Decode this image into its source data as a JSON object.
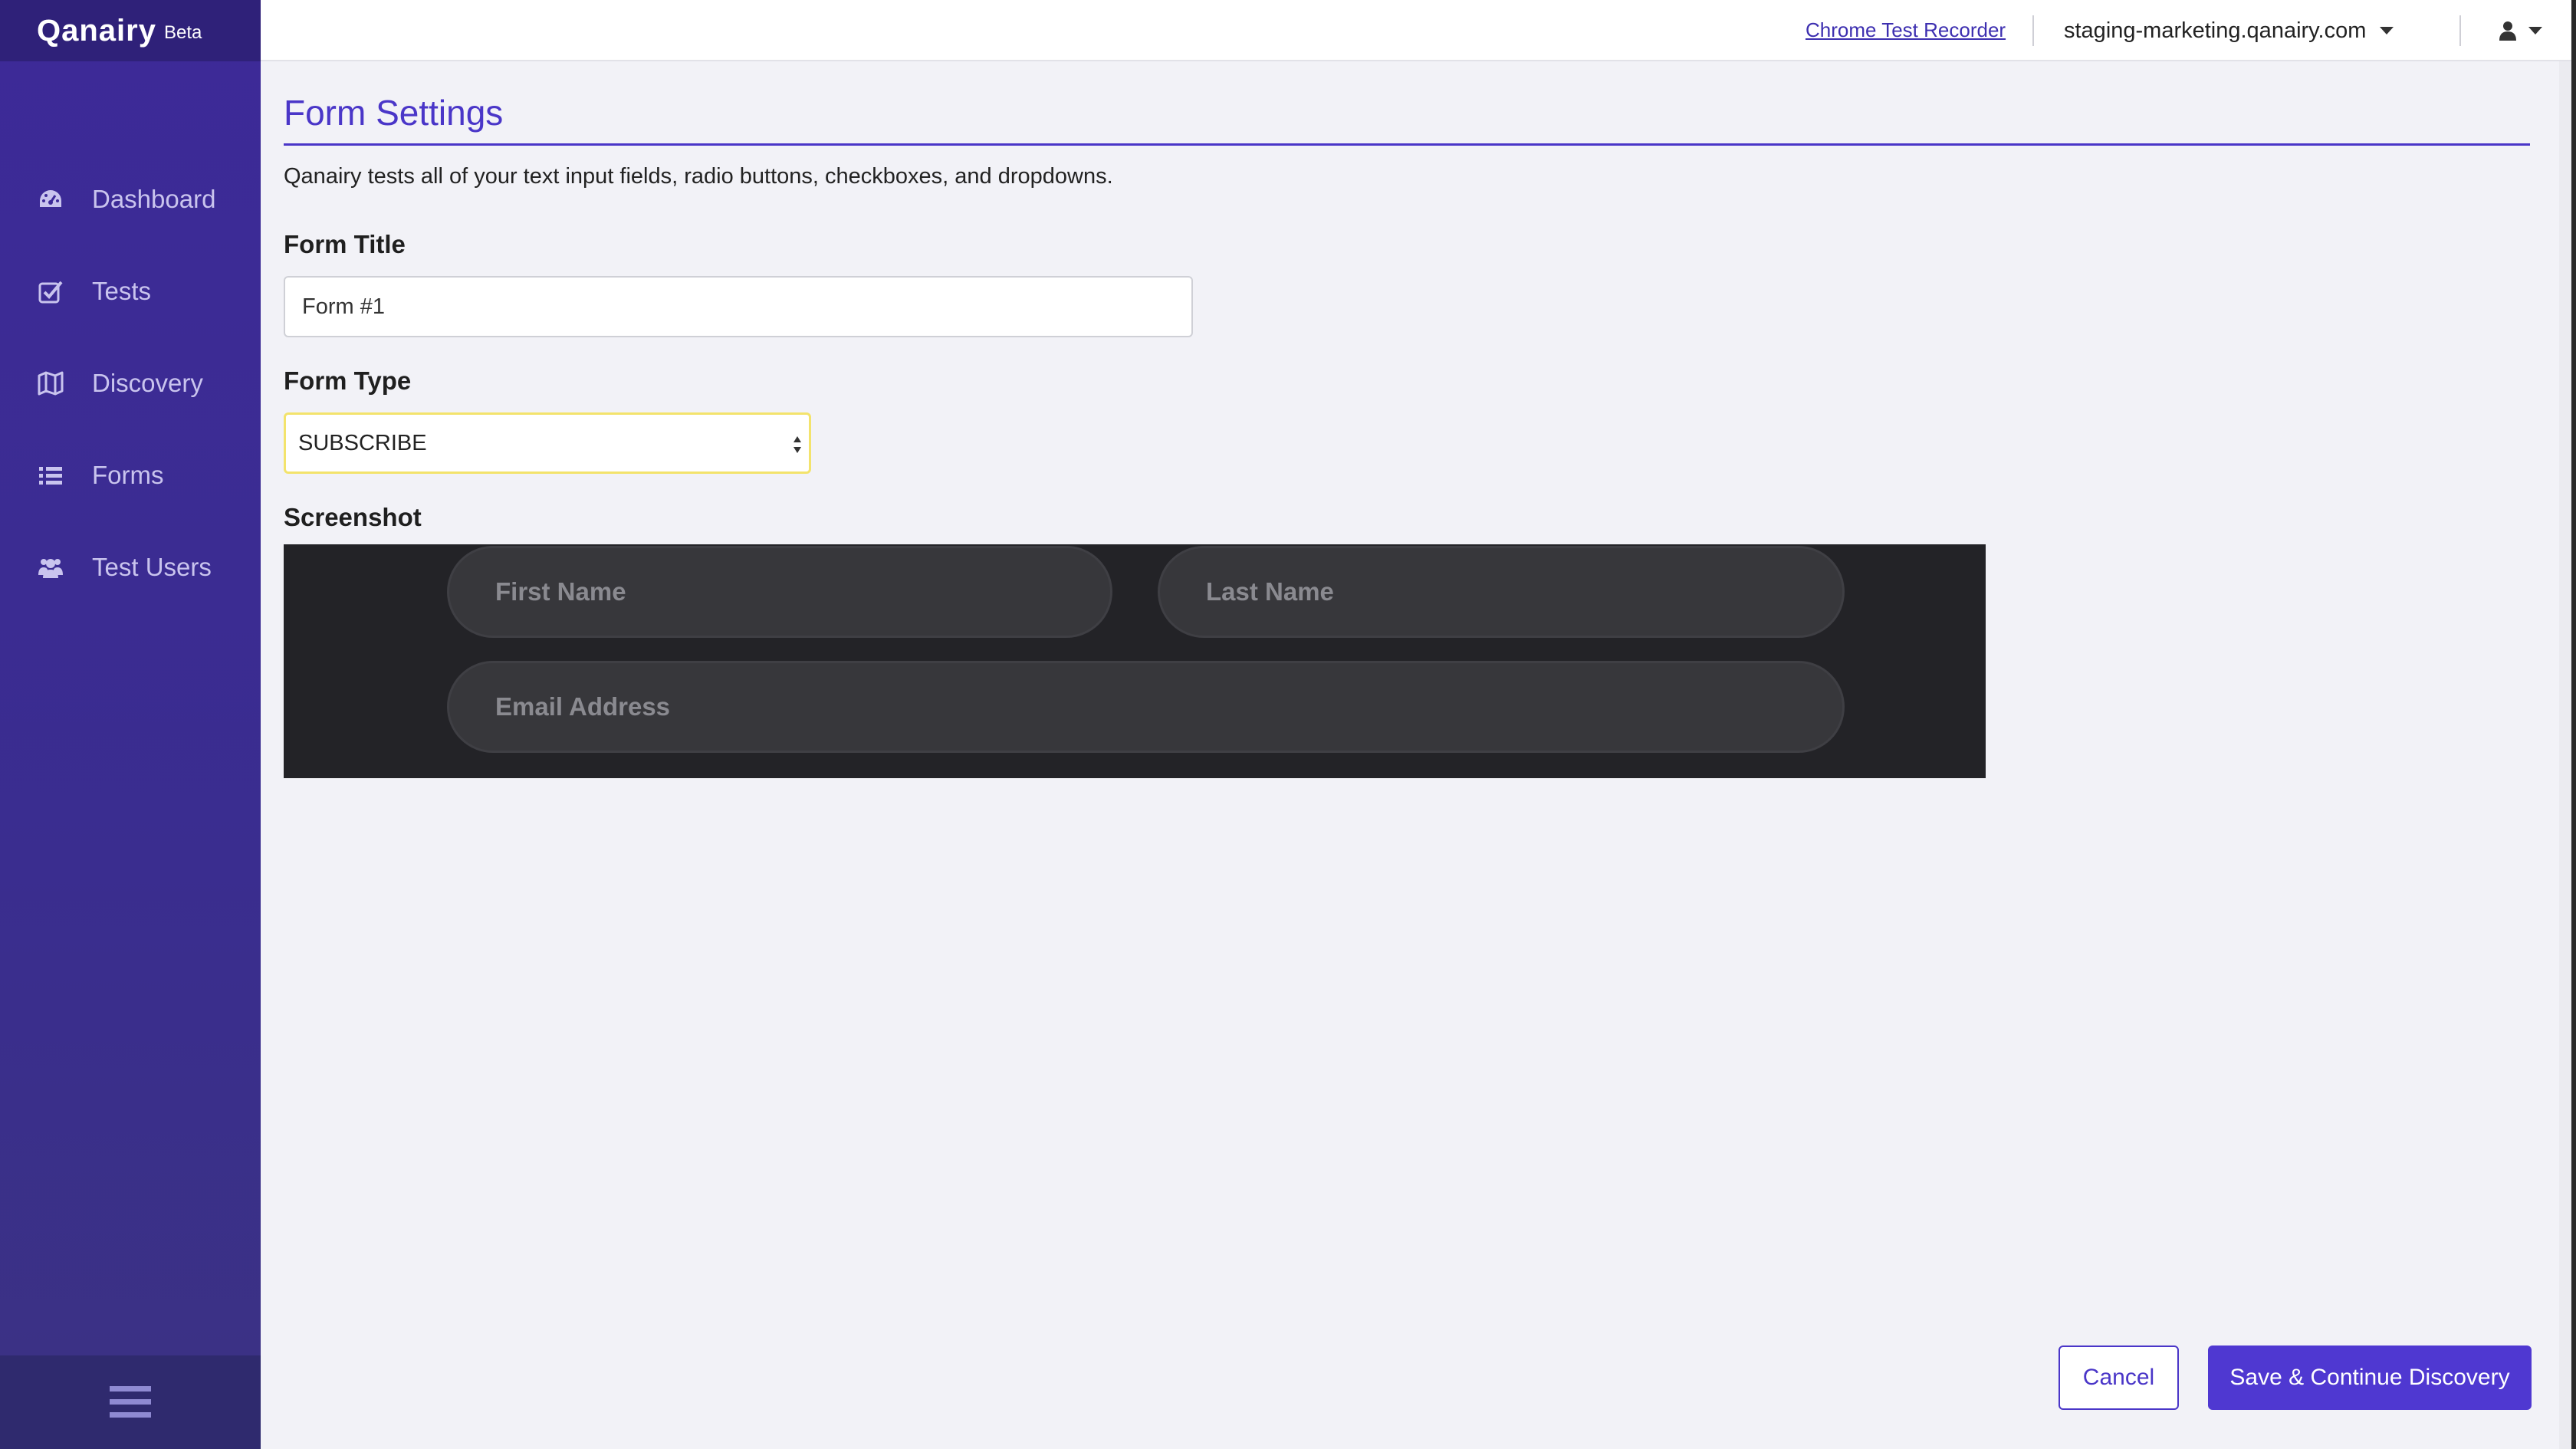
{
  "brand": {
    "name": "Qanairy",
    "badge": "Beta"
  },
  "sidebar": {
    "items": [
      {
        "label": "Dashboard",
        "icon": "dashboard-gauge-icon"
      },
      {
        "label": "Tests",
        "icon": "checkbox-icon"
      },
      {
        "label": "Discovery",
        "icon": "map-icon"
      },
      {
        "label": "Forms",
        "icon": "list-icon"
      },
      {
        "label": "Test Users",
        "icon": "users-icon"
      }
    ],
    "footer_icon": "hamburger-icon"
  },
  "topbar": {
    "recorder_link": "Chrome Test Recorder",
    "domain": "staging-marketing.qanairy.com",
    "user_icon": "user-icon"
  },
  "main": {
    "title": "Form Settings",
    "intro": "Qanairy tests all of your text input fields, radio buttons, checkboxes, and dropdowns.",
    "form_title_label": "Form Title",
    "form_title_value": "Form #1",
    "form_type_label": "Form Type",
    "form_type_value": "SUBSCRIBE",
    "screenshot_label": "Screenshot",
    "screenshot_fields": {
      "first_name": "First Name",
      "last_name": "Last Name",
      "email": "Email Address"
    }
  },
  "actions": {
    "cancel": "Cancel",
    "save": "Save & Continue Discovery"
  },
  "colors": {
    "brand_purple": "#4a36c8",
    "sidebar_bg": "#3d2a98",
    "select_focus": "#f3e36c"
  }
}
